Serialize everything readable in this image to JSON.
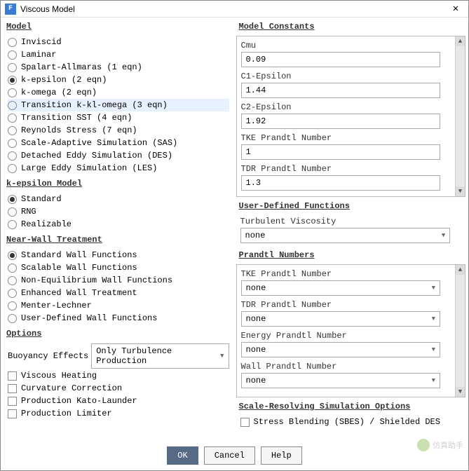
{
  "window": {
    "icon_letter": "F",
    "title": "Viscous Model"
  },
  "model": {
    "title": "Model",
    "items": [
      {
        "label": "Inviscid",
        "checked": false
      },
      {
        "label": "Laminar",
        "checked": false
      },
      {
        "label": "Spalart-Allmaras (1 eqn)",
        "checked": false
      },
      {
        "label": "k-epsilon (2 eqn)",
        "checked": true
      },
      {
        "label": "k-omega (2 eqn)",
        "checked": false
      },
      {
        "label": "Transition k-kl-omega (3 eqn)",
        "checked": false,
        "highlight": true
      },
      {
        "label": "Transition SST (4 eqn)",
        "checked": false
      },
      {
        "label": "Reynolds Stress (7 eqn)",
        "checked": false
      },
      {
        "label": "Scale-Adaptive Simulation (SAS)",
        "checked": false
      },
      {
        "label": "Detached Eddy Simulation (DES)",
        "checked": false
      },
      {
        "label": "Large Eddy Simulation (LES)",
        "checked": false
      }
    ]
  },
  "kepsilon": {
    "title": "k-epsilon Model",
    "items": [
      {
        "label": "Standard",
        "checked": true
      },
      {
        "label": "RNG",
        "checked": false
      },
      {
        "label": "Realizable",
        "checked": false
      }
    ]
  },
  "nearwall": {
    "title": "Near-Wall Treatment",
    "items": [
      {
        "label": "Standard Wall Functions",
        "checked": true
      },
      {
        "label": "Scalable Wall Functions",
        "checked": false
      },
      {
        "label": "Non-Equilibrium Wall Functions",
        "checked": false
      },
      {
        "label": "Enhanced Wall Treatment",
        "checked": false
      },
      {
        "label": "Menter-Lechner",
        "checked": false
      },
      {
        "label": "User-Defined Wall Functions",
        "checked": false
      }
    ]
  },
  "options": {
    "title": "Options",
    "buoyancy_label": "Buoyancy Effects",
    "buoyancy_value": "Only Turbulence Production",
    "checks": [
      {
        "label": "Viscous Heating",
        "checked": false
      },
      {
        "label": "Curvature Correction",
        "checked": false
      },
      {
        "label": "Production Kato-Launder",
        "checked": false
      },
      {
        "label": "Production Limiter",
        "checked": false
      }
    ]
  },
  "constants": {
    "title": "Model Constants",
    "fields": [
      {
        "label": "Cmu",
        "value": "0.09"
      },
      {
        "label": "C1-Epsilon",
        "value": "1.44"
      },
      {
        "label": "C2-Epsilon",
        "value": "1.92"
      },
      {
        "label": "TKE Prandtl Number",
        "value": "1"
      },
      {
        "label": "TDR Prandtl Number",
        "value": "1.3"
      }
    ]
  },
  "udf": {
    "title": "User-Defined Functions",
    "turb_visc_label": "Turbulent Viscosity",
    "turb_visc_value": "none"
  },
  "prandtl": {
    "title": "Prandtl Numbers",
    "fields": [
      {
        "label": "TKE Prandtl Number",
        "value": "none"
      },
      {
        "label": "TDR Prandtl Number",
        "value": "none"
      },
      {
        "label": "Energy Prandtl Number",
        "value": "none"
      },
      {
        "label": "Wall Prandtl Number",
        "value": "none"
      }
    ]
  },
  "scale_resolving": {
    "title": "Scale-Resolving Simulation Options",
    "check": {
      "label": "Stress Blending (SBES) / Shielded DES",
      "checked": false
    }
  },
  "buttons": {
    "ok": "OK",
    "cancel": "Cancel",
    "help": "Help"
  },
  "watermark": "仿真助手"
}
